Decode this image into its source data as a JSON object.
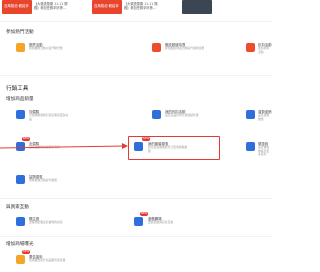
{
  "banners": [
    {
      "img_text": "百萬獎池 輕鬆拿",
      "caption": "【大樂透獎期 11.11 開跑】參加任務拿好禮…",
      "img_color": "#e8452c"
    },
    {
      "img_text": "百萬獎池 輕鬆拿",
      "caption": "【大樂透獎期 11.11 開跑】參加任務拿好禮…",
      "img_color": "#e8452c"
    },
    {
      "img_text": "",
      "caption": "",
      "img_color": "#3b4654"
    }
  ],
  "section_top": {
    "title": "參加熱門活動",
    "cards": [
      {
        "title": "推薦活動",
        "desc": "參加推薦活動以提升曝光量",
        "color": "#f4a62a"
      },
      {
        "title": "蝦皮超值特賣",
        "desc": "參加超值特賣活動提升賣場流量",
        "color": "#ee4d2d"
      },
      {
        "title": "折扣活動",
        "desc": "參加折扣活動",
        "color": "#ee4d2d"
      }
    ]
  },
  "marketing": {
    "title": "行銷工具",
    "subtitle": "增加商品銷量",
    "cards": [
      {
        "title": "加價購",
        "desc": "以加購優惠吸引買家購買更多商品",
        "color": "#2f6fdb"
      },
      {
        "title": "我的折扣活動",
        "desc": "設定商品折扣以增加銷售量",
        "color": "#2f6fdb"
      },
      {
        "title": "運費促銷",
        "desc": "設定運費優惠",
        "color": "#2f6fdb"
      },
      {
        "title": "出價購",
        "desc": "設定出價購方案吸引買家",
        "color": "#2f6fdb",
        "new": "NEW"
      },
      {
        "title": "我的套裝優惠",
        "desc": "建立套裝優惠提升訂單金額與銷量",
        "color": "#2f6fdb",
        "new": "NEW"
      },
      {
        "title": "優惠券",
        "desc": "設定優惠券吸引更多買家",
        "color": "#2f6fdb"
      },
      {
        "title": "搶購優惠",
        "desc": "限時搶購活動提升銷量",
        "color": "#2f6fdb"
      }
    ]
  },
  "interaction": {
    "title": "與買家互動",
    "cards": [
      {
        "title": "關注禮",
        "desc": "送優惠給關注您賣場的買家",
        "color": "#2f6fdb"
      },
      {
        "title": "遊戲賽場",
        "desc": "透過遊戲與買家互動",
        "color": "#2f6fdb",
        "new": "NEW"
      }
    ]
  },
  "exposure": {
    "title": "增加商場曝光",
    "cards": [
      {
        "title": "廣告運用",
        "desc": "使用廣告提升商品曝光與流量",
        "color": "#f4a62a",
        "new": "NEW"
      }
    ]
  },
  "colors": {
    "highlight": "#e53935",
    "arrow": "#e53935"
  }
}
